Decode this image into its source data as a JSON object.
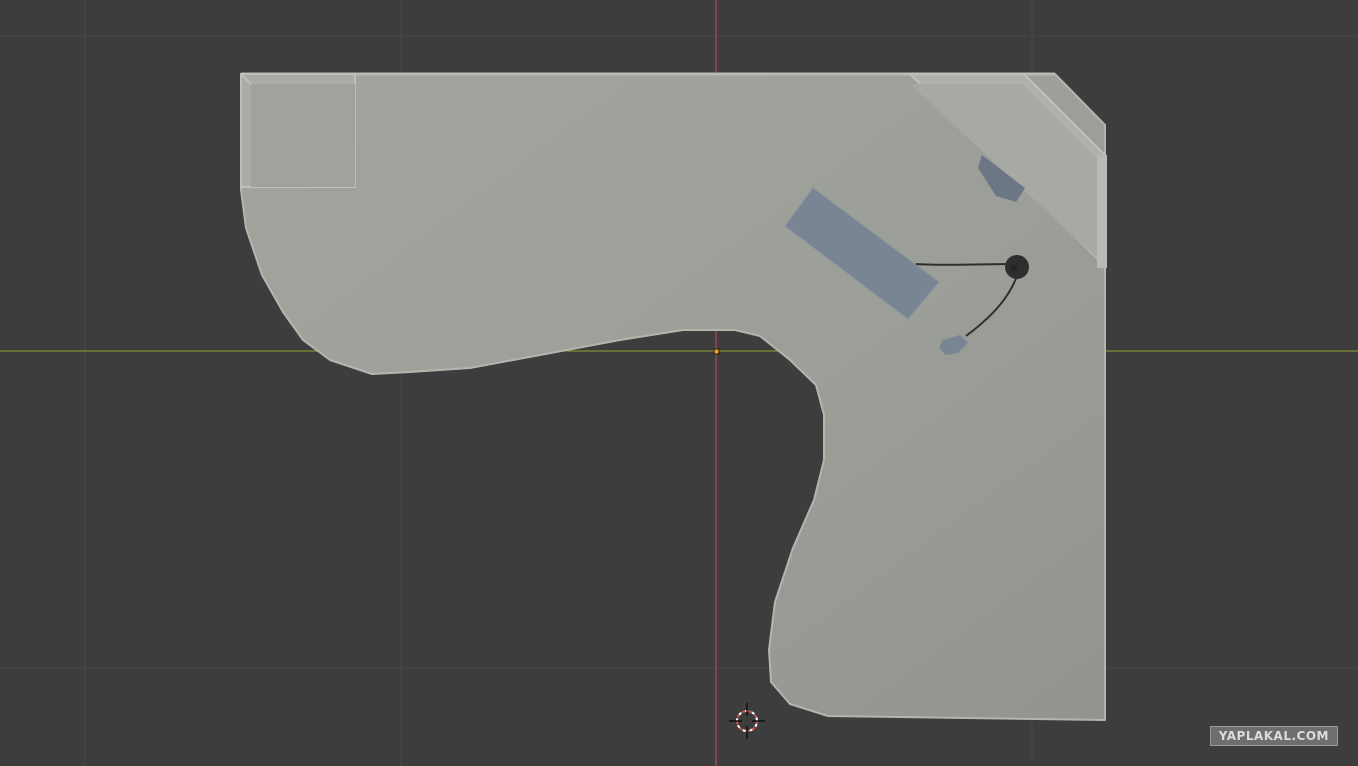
{
  "viewport": {
    "background_color": "#3d3d3d",
    "grid_color": "#474747",
    "x_axis_color": "#8ea234",
    "y_axis_color": "#c94a5e"
  },
  "scene": {
    "desk_color": "#a1a39d",
    "monitor_color": "#b1b2ad",
    "keyboard_color": "#7a8594",
    "speaker_color": "#6c7684",
    "mouse_color": "#7a8594",
    "headset_color": "#2e2e2e"
  },
  "overlay": {
    "origin_icon": "origin-point-icon",
    "cursor_icon": "3d-cursor-icon"
  },
  "watermark": {
    "text": "YAPLAKAL.COM"
  }
}
